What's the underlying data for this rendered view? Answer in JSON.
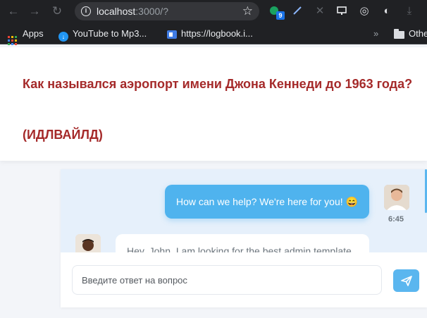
{
  "browser": {
    "url_host": "localhost",
    "url_rest": ":3000/?",
    "extension_badge": "9",
    "bookmarks": [
      {
        "label": "Apps"
      },
      {
        "label": "YouTube to Mp3..."
      },
      {
        "label": "https://logbook.i..."
      },
      {
        "label": "Othe"
      }
    ],
    "overflow": "»"
  },
  "quiz": {
    "question": "Как назывался аэропорт имени Джона Кеннеди до 1963 года?",
    "answer": "(ИДЛВАЙЛД)",
    "accent_color": "#a52a2a"
  },
  "chat": {
    "messages": [
      {
        "direction": "outgoing",
        "text": "How can we help? We're here for you! 😄",
        "time": "6:45"
      },
      {
        "direction": "incoming",
        "text": "Hey, John, I am looking for the best admin template"
      }
    ],
    "input": {
      "placeholder": "Введите ответ на вопрос",
      "value": ""
    },
    "send_icon": "paper-plane-icon",
    "bubble_color": "#4fb3ee"
  }
}
